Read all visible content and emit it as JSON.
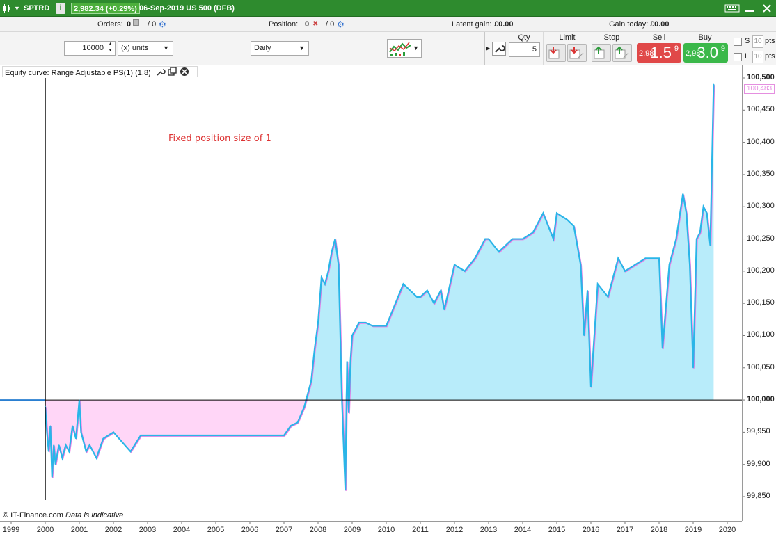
{
  "title_bar": {
    "symbol": "SPTRD",
    "info_label": "i",
    "price_change": "2,982.34 (+0.29%)",
    "market": "06-Sep-2019 US 500 (DFB)",
    "caret": "▼"
  },
  "status_row": {
    "orders_label": "Orders:",
    "orders_value": "0",
    "orders_total": "/ 0",
    "position_label": "Position:",
    "position_value": "0",
    "position_total": "/ 0",
    "latent_gain_label": "Latent gain:",
    "latent_gain_value": "£0.00",
    "gain_today_label": "Gain today:",
    "gain_today_value": "£0.00"
  },
  "toolbar": {
    "quantity_value": "10000",
    "units_option": "(x) units",
    "period_option": "Daily",
    "qty_label": "Qty",
    "qty_value": "5",
    "limit_label": "Limit",
    "stop_label": "Stop",
    "sell_label": "Sell",
    "buy_label": "Buy",
    "sell_prefix": "2,98",
    "sell_main": "1.5",
    "sell_sup": "9",
    "buy_prefix": "2,98",
    "buy_main": "3.0",
    "buy_sup": "9",
    "short_label": "S",
    "long_label": "L",
    "pts_value": "10",
    "pts_label": "pts"
  },
  "chart": {
    "legend": "Equity curve: Range Adjustable PS(1) (1.8)",
    "annotation": "Fixed position size of 1",
    "current_value_tag": "100,483",
    "copyright": "© IT-Finance.com",
    "disclaimer": "Data is indicative",
    "colors": {
      "line": "#29b6e8",
      "positive_fill": "#b8ecfa",
      "negative_fill": "#ffd6f7",
      "negative_line": "#f07ae6",
      "baseline": "#000000"
    }
  },
  "chart_data": {
    "type": "area",
    "title": "Equity curve: Range Adjustable PS(1) (1.8)",
    "xlabel": "",
    "ylabel": "",
    "baseline": 100000,
    "ylim": [
      99820,
      100510
    ],
    "y_ticks": [
      "100,500",
      "100,450",
      "100,400",
      "100,350",
      "100,300",
      "100,250",
      "100,200",
      "100,150",
      "100,100",
      "100,050",
      "100,000",
      "99,950",
      "99,900",
      "99,850"
    ],
    "x_ticks": [
      "1999",
      "2000",
      "2001",
      "2002",
      "2003",
      "2004",
      "2005",
      "2006",
      "2007",
      "2008",
      "2009",
      "2010",
      "2011",
      "2012",
      "2013",
      "2014",
      "2015",
      "2016",
      "2017",
      "2018",
      "2019",
      "2020"
    ],
    "x": [
      2000.0,
      2000.05,
      2000.1,
      2000.15,
      2000.2,
      2000.25,
      2000.3,
      2000.4,
      2000.5,
      2000.6,
      2000.7,
      2000.8,
      2000.9,
      2001.0,
      2001.05,
      2001.2,
      2001.3,
      2001.5,
      2001.7,
      2002.0,
      2002.5,
      2002.8,
      2003.0,
      2003.5,
      2004.0,
      2005.0,
      2006.0,
      2007.0,
      2007.2,
      2007.4,
      2007.6,
      2007.7,
      2007.8,
      2007.9,
      2008.0,
      2008.1,
      2008.2,
      2008.3,
      2008.4,
      2008.5,
      2008.6,
      2008.7,
      2008.8,
      2008.85,
      2008.9,
      2008.95,
      2009.0,
      2009.1,
      2009.2,
      2009.4,
      2009.6,
      2010.0,
      2010.5,
      2010.9,
      2011.0,
      2011.2,
      2011.4,
      2011.6,
      2011.7,
      2012.0,
      2012.3,
      2012.6,
      2012.9,
      2013.0,
      2013.3,
      2013.7,
      2014.0,
      2014.3,
      2014.6,
      2014.9,
      2015.0,
      2015.3,
      2015.5,
      2015.7,
      2015.8,
      2015.9,
      2016.0,
      2016.2,
      2016.5,
      2016.8,
      2017.0,
      2017.3,
      2017.6,
      2018.0,
      2018.1,
      2018.3,
      2018.5,
      2018.7,
      2018.8,
      2018.9,
      2019.0,
      2019.1,
      2019.2,
      2019.3,
      2019.4,
      2019.5,
      2019.6
    ],
    "y": [
      99990,
      99950,
      99920,
      99960,
      99880,
      99930,
      99900,
      99930,
      99910,
      99930,
      99920,
      99960,
      99940,
      100000,
      99950,
      99920,
      99930,
      99910,
      99940,
      99950,
      99920,
      99945,
      99945,
      99945,
      99945,
      99945,
      99945,
      99945,
      99960,
      99965,
      99990,
      100010,
      100030,
      100080,
      100120,
      100190,
      100180,
      100200,
      100230,
      100250,
      100210,
      100000,
      99860,
      100060,
      99980,
      100060,
      100100,
      100110,
      100120,
      100120,
      100115,
      100115,
      100180,
      100160,
      100160,
      100170,
      100150,
      100170,
      100140,
      100210,
      100200,
      100220,
      100250,
      100250,
      100230,
      100250,
      100250,
      100260,
      100290,
      100250,
      100290,
      100280,
      100270,
      100210,
      100100,
      100170,
      100020,
      100180,
      100160,
      100220,
      100200,
      100210,
      100220,
      100220,
      100080,
      100210,
      100250,
      100320,
      100290,
      100210,
      100050,
      100250,
      100260,
      100300,
      100290,
      100240,
      100490
    ]
  }
}
